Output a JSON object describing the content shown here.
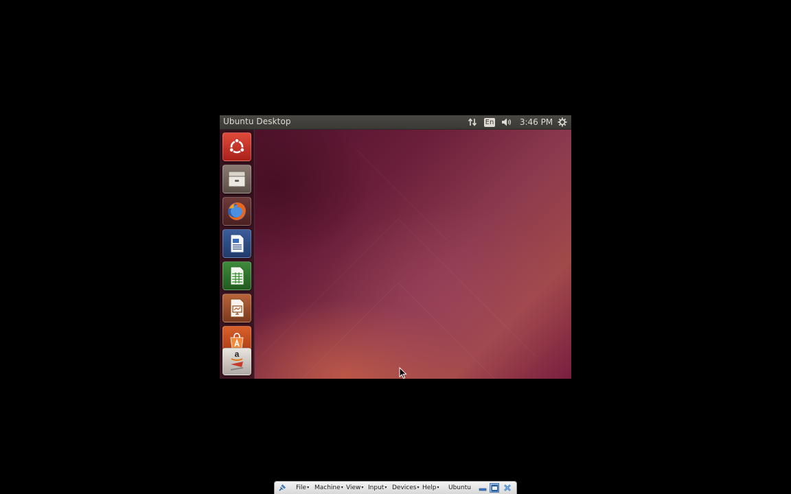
{
  "guest": {
    "panel": {
      "title": "Ubuntu Desktop",
      "keyboard_layout": "En",
      "clock": "3:46 PM"
    },
    "launcher": {
      "items": [
        {
          "name": "dash-home",
          "icon": "ubuntu-logo-icon"
        },
        {
          "name": "files",
          "icon": "file-cabinet-icon"
        },
        {
          "name": "firefox",
          "icon": "firefox-icon"
        },
        {
          "name": "libreoffice-writer",
          "icon": "writer-document-icon"
        },
        {
          "name": "libreoffice-calc",
          "icon": "calc-spreadsheet-icon"
        },
        {
          "name": "libreoffice-impress",
          "icon": "impress-presentation-icon"
        },
        {
          "name": "ubuntu-software-center",
          "icon": "shopping-bag-icon"
        },
        {
          "name": "amazon",
          "icon": "amazon-icon"
        }
      ]
    }
  },
  "vbox_toolbar": {
    "menus": [
      "File",
      "Machine",
      "View",
      "Input",
      "Devices",
      "Help"
    ],
    "vm_name": "Ubuntu"
  },
  "colors": {
    "panel_bg": "#3a3935",
    "panel_text": "#dfdbd2",
    "ubuntu_orange": "#dd4814",
    "aubergine": "#5e2750"
  }
}
